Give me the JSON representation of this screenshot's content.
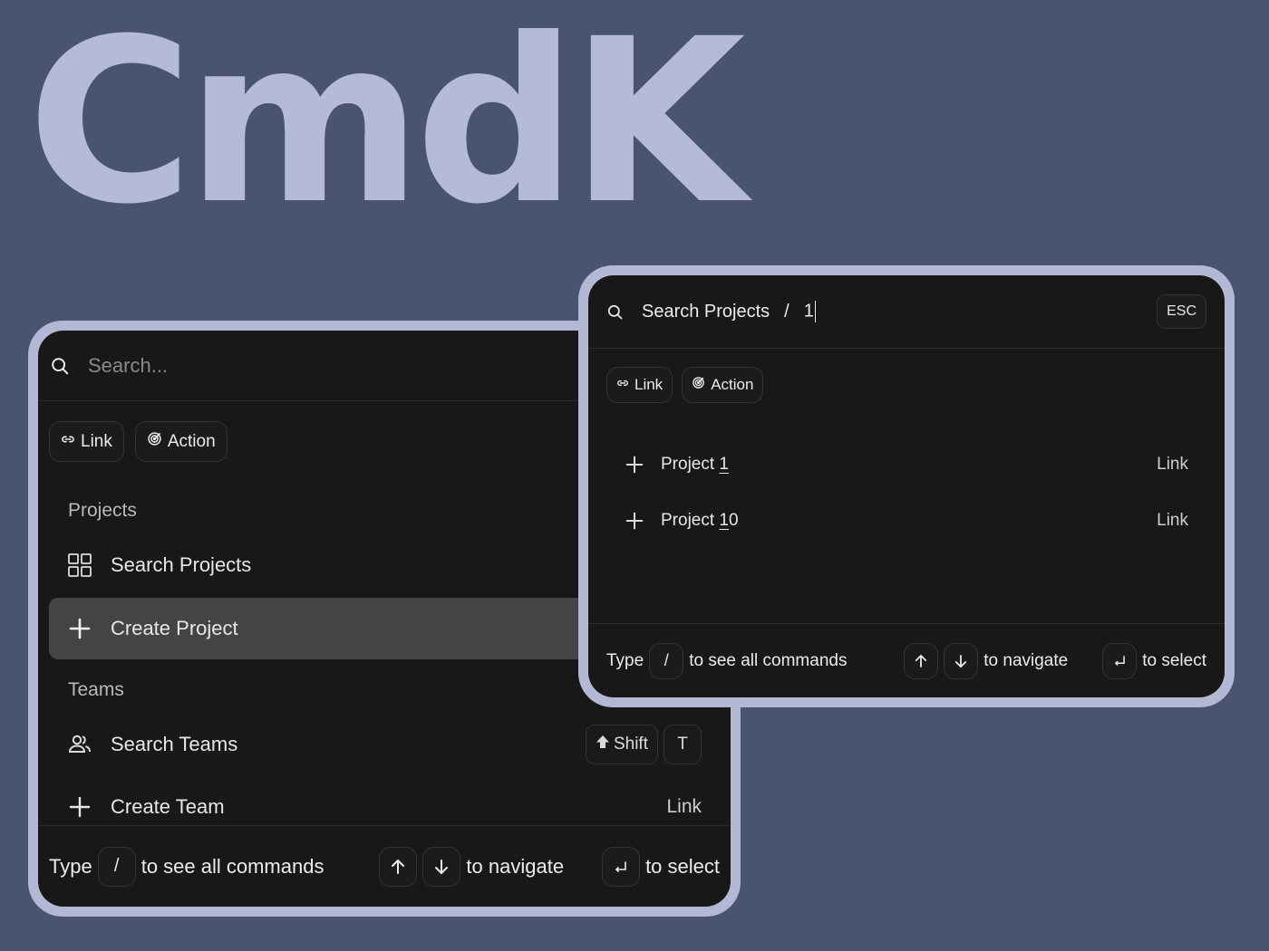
{
  "hero": {
    "title": "CmdK"
  },
  "back_palette": {
    "search": {
      "placeholder": "Search..."
    },
    "chips": [
      {
        "label": "Link",
        "icon": "link-icon"
      },
      {
        "label": "Action",
        "icon": "target-icon"
      }
    ],
    "groups": [
      {
        "title": "Projects",
        "items": [
          {
            "label": "Search Projects",
            "icon": "grid-icon",
            "active": false
          },
          {
            "label": "Create Project",
            "icon": "plus-icon",
            "active": true
          }
        ]
      },
      {
        "title": "Teams",
        "items": [
          {
            "label": "Search Teams",
            "icon": "users-icon",
            "shortcut": [
              "Shift",
              "T"
            ]
          },
          {
            "label": "Create Team",
            "icon": "plus-icon",
            "type": "Link"
          }
        ]
      }
    ],
    "footer": {
      "type_label": "Type",
      "slash_key": "/",
      "see_all": "to see all commands",
      "navigate": "to navigate",
      "select": "to select"
    }
  },
  "front_palette": {
    "search": {
      "context": "Search Projects",
      "separator": "/",
      "query": "1",
      "esc": "ESC"
    },
    "chips": [
      {
        "label": "Link",
        "icon": "link-icon"
      },
      {
        "label": "Action",
        "icon": "target-icon"
      }
    ],
    "results": [
      {
        "prefix": "Project ",
        "match": "1",
        "suffix": "",
        "type": "Link"
      },
      {
        "prefix": "Project ",
        "match": "1",
        "suffix": "0",
        "type": "Link"
      }
    ],
    "footer": {
      "type_label": "Type",
      "slash_key": "/",
      "see_all": "to see all commands",
      "navigate": "to navigate",
      "select": "to select"
    }
  },
  "colors": {
    "background": "#4a5372",
    "hero": "#b4bbd8",
    "frame": "#b3b9d5",
    "palette": "#181818",
    "active_item": "#444444"
  }
}
